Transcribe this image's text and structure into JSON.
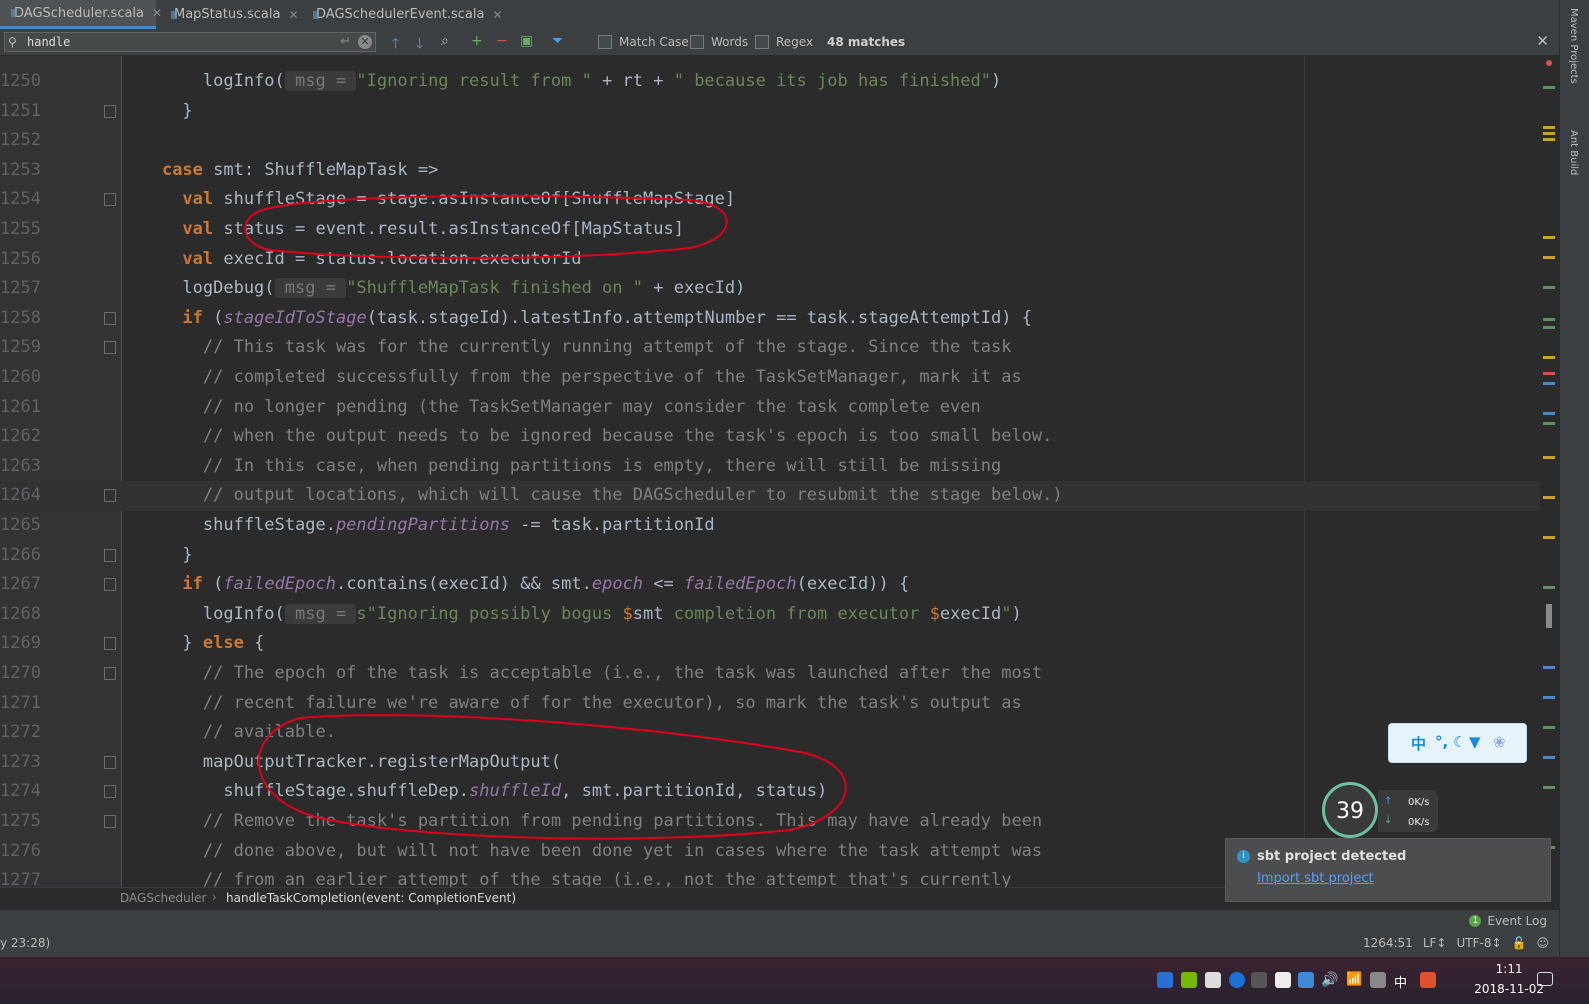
{
  "tabs": [
    {
      "label": "DAGScheduler.scala",
      "active": true
    },
    {
      "label": "MapStatus.scala",
      "active": false
    },
    {
      "label": "DAGSchedulerEvent.scala",
      "active": false
    }
  ],
  "find": {
    "query": "handle",
    "match_case_label": "Match Case",
    "words_label": "Words",
    "regex_label": "Regex",
    "matches_label": "48 matches"
  },
  "code_lines": [
    {
      "n": "1250",
      "html": "        logInfo(<span class='hint'> msg = </span><span class='str'>\"Ignoring result from \"</span> + rt + <span class='str'>\" because its job has finished\"</span>)"
    },
    {
      "n": "1251",
      "html": "      }"
    },
    {
      "n": "1252",
      "html": ""
    },
    {
      "n": "1253",
      "html": "    <span class='kw'>case</span> smt: ShuffleMapTask =>"
    },
    {
      "n": "1254",
      "html": "      <span class='kw'>val</span> shuffleStage = stage.asInstanceOf[ShuffleMapStage]"
    },
    {
      "n": "1255",
      "html": "      <span class='kw'>val</span> status = event.result.asInstanceOf[MapStatus]"
    },
    {
      "n": "1256",
      "html": "      <span class='kw'>val</span> execId = status.location.executorId"
    },
    {
      "n": "1257",
      "html": "      logDebug(<span class='hint'> msg = </span><span class='str'>\"ShuffleMapTask finished on \"</span> + execId)"
    },
    {
      "n": "1258",
      "html": "      <span class='kw'>if</span> (<span class='it'>stageIdToStage</span>(task.stageId).latestInfo.attemptNumber == task.stageAttemptId) {"
    },
    {
      "n": "1259",
      "html": "        <span class='cmt'>// This task was for the currently running attempt of the stage. Since the task</span>"
    },
    {
      "n": "1260",
      "html": "        <span class='cmt'>// completed successfully from the perspective of the TaskSetManager, mark it as</span>"
    },
    {
      "n": "1261",
      "html": "        <span class='cmt'>// no longer pending (the TaskSetManager may consider the task complete even</span>"
    },
    {
      "n": "1262",
      "html": "        <span class='cmt'>// when the output needs to be ignored because the task's epoch is too small below.</span>"
    },
    {
      "n": "1263",
      "html": "        <span class='cmt'>// In this case, when pending partitions is empty, there will still be missing</span>"
    },
    {
      "n": "1264",
      "html": "        <span class='cmt'>// output locations, which will cause the DAGScheduler to resubmit the stage below.)</span>"
    },
    {
      "n": "1265",
      "html": "        shuffleStage.<span class='it'>pendingPartitions</span> -= task.partitionId"
    },
    {
      "n": "1266",
      "html": "      }"
    },
    {
      "n": "1267",
      "html": "      <span class='kw'>if</span> (<span class='it'>failedEpoch</span>.contains(execId) &amp;&amp; smt.<span class='it'>epoch</span> &lt;= <span class='it'>failedEpoch</span>(execId)) {"
    },
    {
      "n": "1268",
      "html": "        logInfo(<span class='hint'> msg = </span><span class='str'>s\"Ignoring possibly bogus </span><span class='tpl'>$</span>smt<span class='str'> completion from executor </span><span class='tpl'>$</span>execId<span class='str'>\"</span>)"
    },
    {
      "n": "1269",
      "html": "      } <span class='kw'>else</span> {"
    },
    {
      "n": "1270",
      "html": "        <span class='cmt'>// The epoch of the task is acceptable (i.e., the task was launched after the most</span>"
    },
    {
      "n": "1271",
      "html": "        <span class='cmt'>// recent failure we're aware of for the executor), so mark the task's output as</span>"
    },
    {
      "n": "1272",
      "html": "        <span class='cmt'>// available.</span>"
    },
    {
      "n": "1273",
      "html": "        mapOutputTracker.registerMapOutput("
    },
    {
      "n": "1274",
      "html": "          shuffleStage.shuffleDep.<span class='it'>shuffleId</span>, smt.partitionId, status)"
    },
    {
      "n": "1275",
      "html": "        <span class='cmt'>// Remove the task's partition from pending partitions. This may have already been</span>"
    },
    {
      "n": "1276",
      "html": "        <span class='cmt'>// done above, but will not have been done yet in cases where the task attempt was</span>"
    },
    {
      "n": "1277",
      "html": "        <span class='cmt'>// from an earlier attempt of the stage (i.e., not the attempt that's currently</span>"
    }
  ],
  "breadcrumb": {
    "class": "DAGScheduler",
    "method": "handleTaskCompletion(event: CompletionEvent)"
  },
  "statusbar": {
    "left": "y 23:28)",
    "position": "1264:51",
    "line_sep": "LF↕",
    "encoding": "UTF-8↕",
    "event_log": "Event Log"
  },
  "notification": {
    "title": "sbt project detected",
    "link": "Import sbt project"
  },
  "widget": {
    "cpu": "39",
    "cpu_unit": "%",
    "up": "0K/s",
    "down": "0K/s"
  },
  "ime": {
    "char": "中"
  },
  "clock": {
    "time": "1:11",
    "date": "2018-11-02"
  },
  "sidebar": {
    "maven": "Maven Projects",
    "ant": "Ant Build"
  },
  "colors": {
    "accent": "#4a88c7",
    "keyword": "#cc7832",
    "string": "#6a8759",
    "comment": "#808080",
    "annotation": "#e0001b"
  }
}
